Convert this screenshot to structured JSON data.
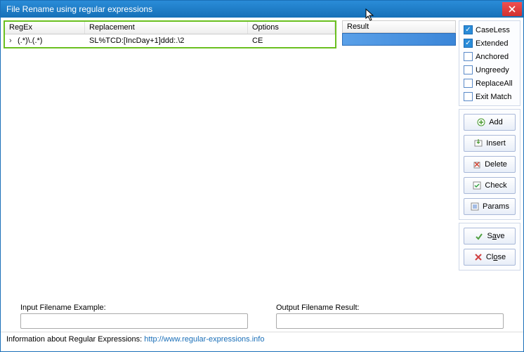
{
  "window": {
    "title": "File Rename using regular expressions"
  },
  "table": {
    "headers": {
      "regex": "RegEx",
      "replacement": "Replacement",
      "options": "Options"
    },
    "rows": [
      {
        "regex": "(.*)\\.(.*)",
        "replacement": "SL%TCD:[IncDay+1]ddd:.\\2",
        "options": "CE"
      }
    ]
  },
  "result": {
    "label": "Result"
  },
  "checks": {
    "caseless": {
      "label": "CaseLess",
      "checked": true
    },
    "extended": {
      "label": "Extended",
      "checked": true
    },
    "anchored": {
      "label": "Anchored",
      "checked": false
    },
    "ungreedy": {
      "label": "Ungreedy",
      "checked": false
    },
    "replaceall": {
      "label": "ReplaceAll",
      "checked": false
    },
    "exitmatch": {
      "label": "Exit Match",
      "checked": false
    }
  },
  "buttons": {
    "add": "Add",
    "insert": "Insert",
    "delete": "Delete",
    "check": "Check",
    "params": "Params",
    "save_pre": "S",
    "save_u": "a",
    "save_post": "ve",
    "close_pre": "Cl",
    "close_u": "o",
    "close_post": "se"
  },
  "bottom": {
    "input_label": "Input Filename Example:",
    "output_label": "Output Filename Result:",
    "input_value": "",
    "output_value": ""
  },
  "footer": {
    "text": "Information about Regular Expressions: ",
    "link": "http://www.regular-expressions.info"
  }
}
